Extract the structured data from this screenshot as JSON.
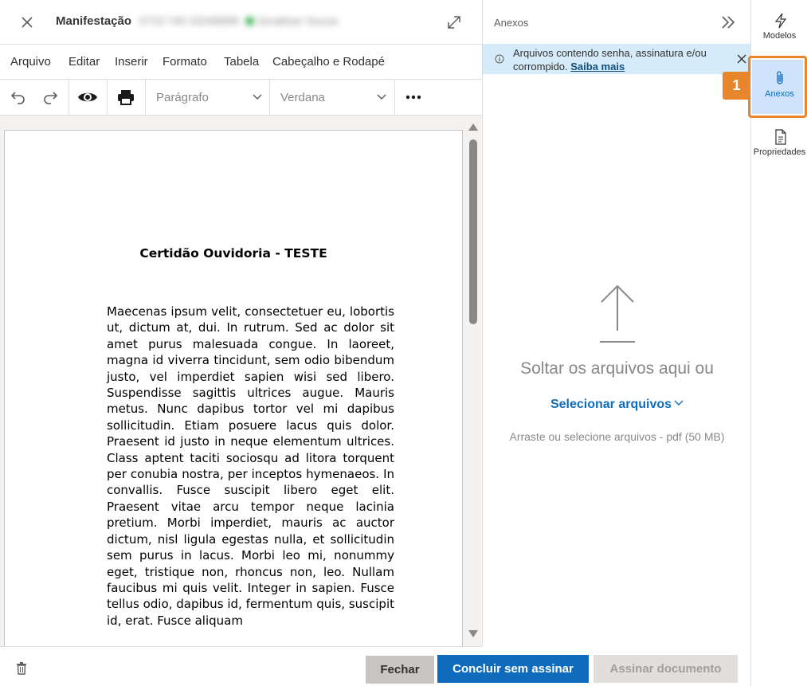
{
  "header": {
    "title": "Manifestação",
    "subtitle_redacted": "0719 740 20248898",
    "user_redacted": "Jonathan Souza"
  },
  "menu": [
    "Arquivo",
    "Editar",
    "Inserir",
    "Formato",
    "Tabela",
    "Cabeçalho e Rodapé"
  ],
  "toolbar": {
    "paragraph_select": "Parágrafo",
    "font_select": "Verdana"
  },
  "document": {
    "heading": "Certidão Ouvidoria - TESTE",
    "body": "Maecenas ipsum velit, consectetuer eu, lobortis ut, dictum at, dui. In rutrum. Sed ac dolor sit amet purus malesuada congue. In laoreet, magna id viverra tincidunt, sem odio bibendum justo, vel imperdiet sapien wisi sed libero. Suspendisse sagittis ultrices augue. Mauris metus. Nunc dapibus tortor vel mi dapibus sollicitudin. Etiam posuere lacus quis dolor. Praesent id justo in neque elementum ultrices. Class aptent taciti sociosqu ad litora torquent per conubia nostra, per inceptos hymenaeos. In convallis. Fusce suscipit libero eget elit. Praesent vitae arcu tempor neque lacinia pretium. Morbi imperdiet, mauris ac auctor dictum, nisl ligula egestas nulla, et sollicitudin sem purus in lacus. Morbi leo mi, nonummy eget, tristique non, rhoncus non, leo. Nullam faucibus mi quis velit. Integer in sapien. Fusce tellus odio, dapibus id, fermentum quis, suscipit id, erat. Fusce aliquam"
  },
  "footer": {
    "close_label": "Fechar",
    "finish_label": "Concluir sem assinar",
    "sign_label": "Assinar documento"
  },
  "attachments": {
    "title": "Anexos",
    "info_text": "Arquivos contendo senha, assinatura e/ou corrompido.",
    "info_link": "Saiba mais",
    "drop_text": "Soltar os arquivos aqui ou",
    "select_label": "Selecionar arquivos",
    "hint": "Arraste ou selecione arquivos - pdf (50 MB)"
  },
  "rail": {
    "items": [
      {
        "label": "Modelos",
        "icon": "lightning-icon"
      },
      {
        "label": "Anexos",
        "icon": "paperclip-icon",
        "selected": true
      },
      {
        "label": "Propriedades",
        "icon": "document-properties-icon"
      }
    ],
    "step_badge": "1"
  },
  "colors": {
    "primary": "#0f6cbd",
    "highlight": "#e8862e",
    "info_bg": "#d6ebf9",
    "selected_bg": "#cfe4fa"
  }
}
